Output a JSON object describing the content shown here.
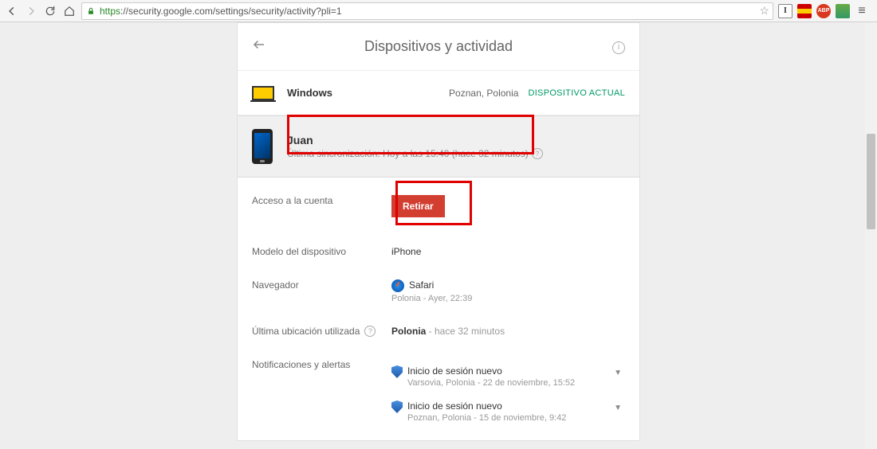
{
  "browser": {
    "url_host": "https",
    "url_domain": "://security.google.com",
    "url_path": "/settings/security/activity?pli=1"
  },
  "header": {
    "title": "Dispositivos y actividad"
  },
  "current_device": {
    "name": "Windows",
    "location": "Poznan, Polonia",
    "badge": "DISPOSITIVO ACTUAL"
  },
  "device": {
    "name": "Juan",
    "sync_text": "Última sincronización: Hoy a las 15:40 (hace 32 minutos)"
  },
  "details": {
    "access_label": "Acceso a la cuenta",
    "remove_button": "Retirar",
    "model_label": "Modelo del dispositivo",
    "model_value": "iPhone",
    "browser_label": "Navegador",
    "browser_value": "Safari",
    "browser_sub": "Polonia - Ayer, 22:39",
    "location_label": "Última ubicación utilizada",
    "location_value": "Polonia",
    "location_sub": " - hace 32 minutos",
    "notifications_label": "Notificaciones y alertas",
    "notifications": [
      {
        "title": "Inicio de sesión nuevo",
        "sub": "Varsovia, Polonia - 22 de noviembre, 15:52"
      },
      {
        "title": "Inicio de sesión nuevo",
        "sub": "Poznan, Polonia - 15 de noviembre, 9:42"
      }
    ]
  }
}
